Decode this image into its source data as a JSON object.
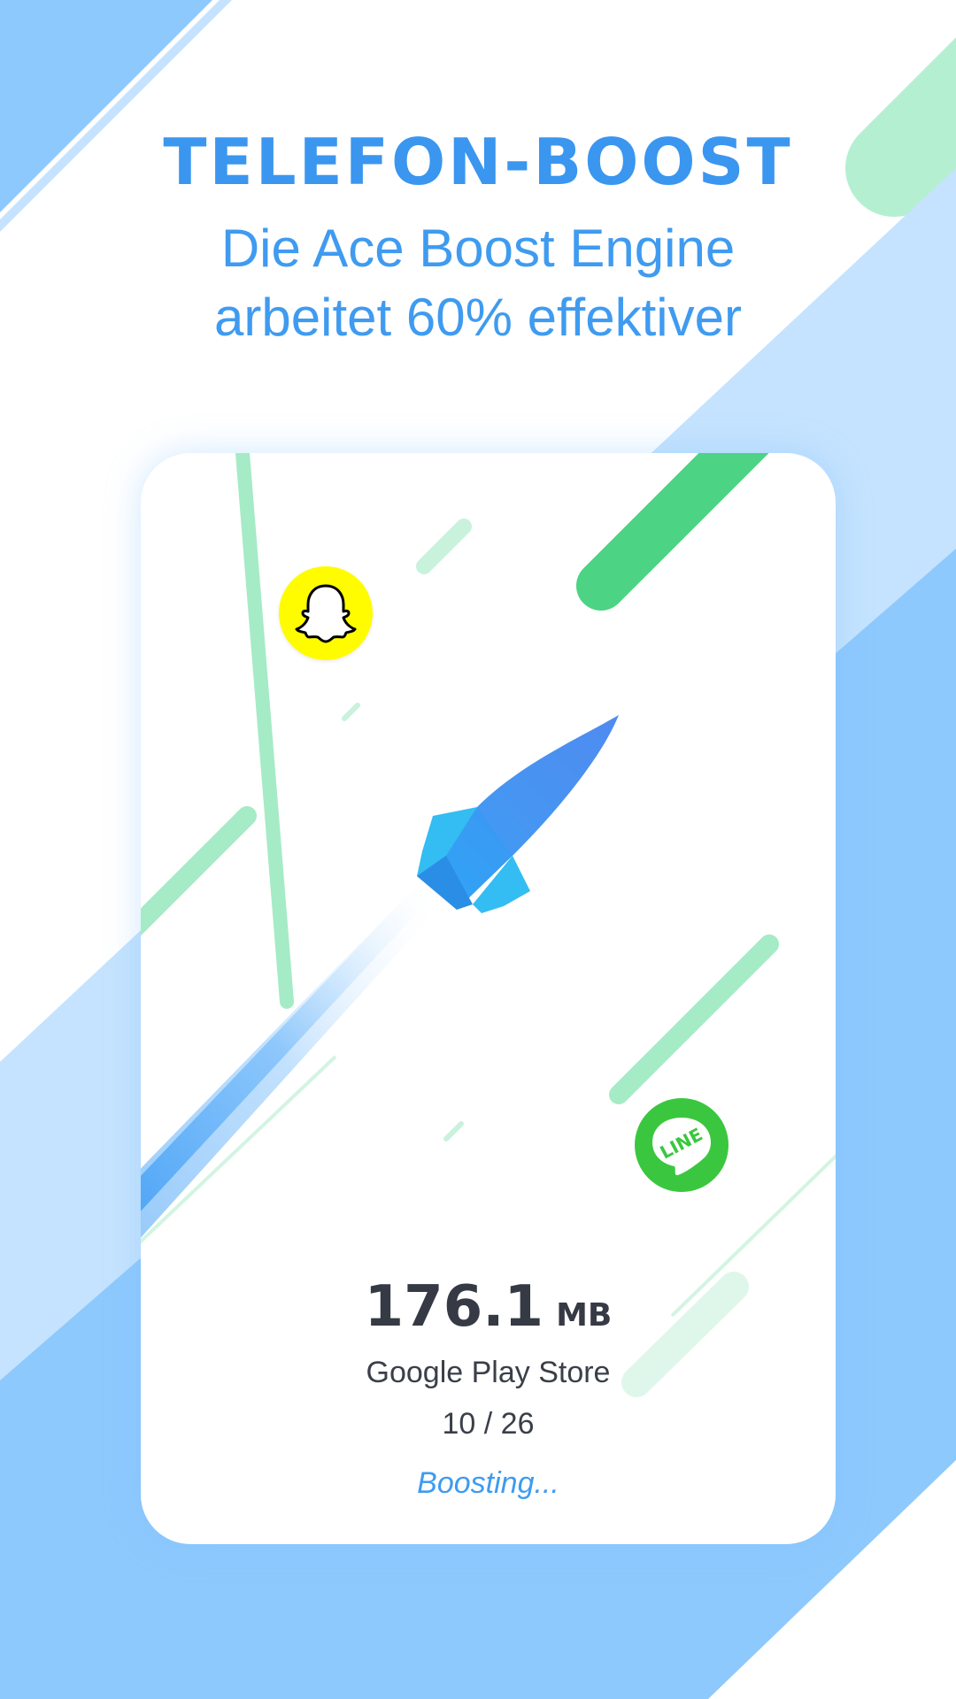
{
  "header": {
    "title": "TELEFON-BOOST",
    "subtitle_line1": "Die Ace Boost Engine",
    "subtitle_line2": "arbeitet 60% effektiver"
  },
  "boost_card": {
    "size_value": "176.1",
    "size_unit": "MB",
    "current_app": "Google Play Store",
    "progress_text": "10 / 26",
    "progress": {
      "done": 10,
      "total": 26
    },
    "status_text": "Boosting...",
    "icons": [
      "snapchat-icon",
      "line-icon",
      "rocket-icon"
    ],
    "line_icon_text": "LINE"
  },
  "colors": {
    "accent_blue": "#3f9bf0",
    "background_blue": "#8ec9fd",
    "light_blue": "#c5e3fe",
    "green": "#4cd384",
    "light_green": "#b5efd1",
    "snapchat_yellow": "#fffc00",
    "line_green": "#3ac73f",
    "text_dark": "#353a45"
  }
}
